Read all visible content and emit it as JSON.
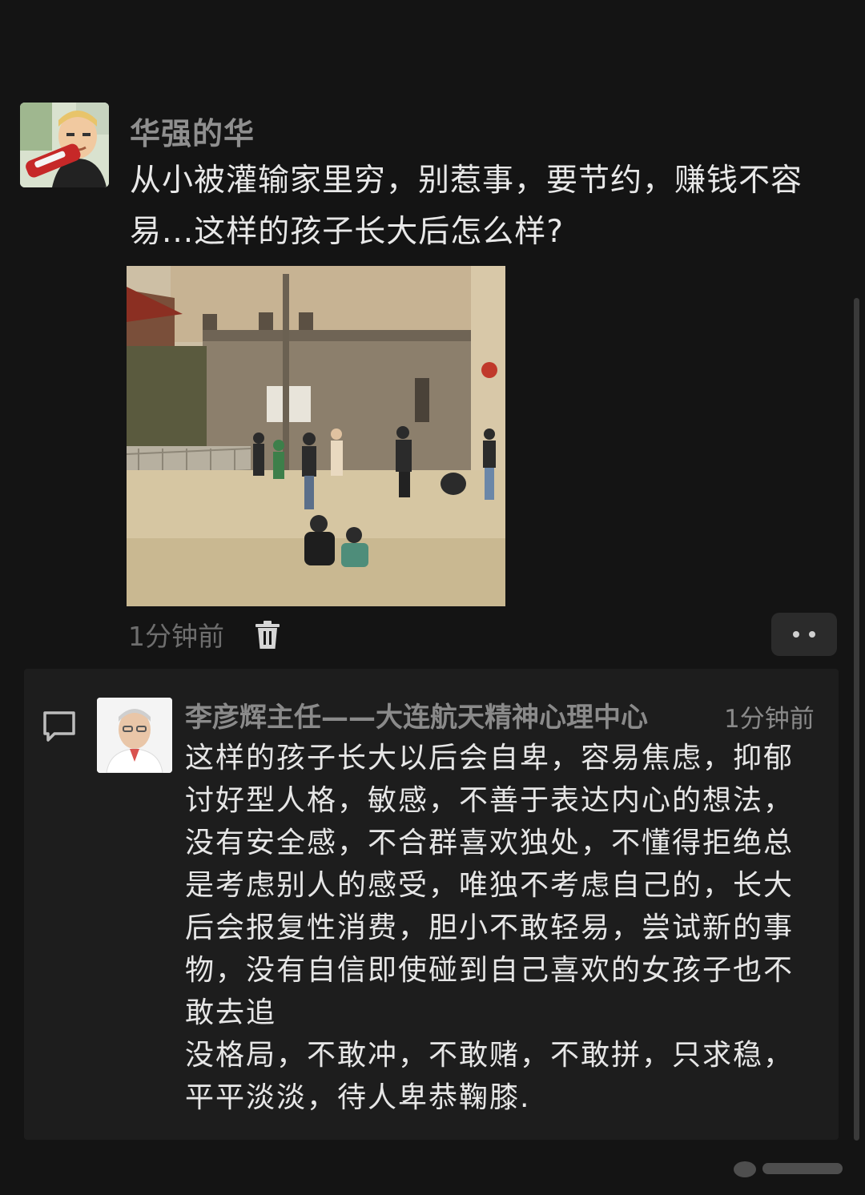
{
  "post": {
    "username": "华强的华",
    "text": "从小被灌输家里穷，别惹事，要节约，赚钱不容易...这样的孩子长大后怎么样?",
    "time": "1分钟前",
    "avatar_icon": "cartoon-man-avatar",
    "image_subject": "children-playing-in-village-yard"
  },
  "comment": {
    "author": "李彦辉主任——大连航天精神心理中心",
    "time": "1分钟前",
    "text": "这样的孩子长大以后会自卑，容易焦虑，抑郁讨好型人格，敏感，不善于表达内心的想法，没有安全感，不合群喜欢独处，不懂得拒绝总是考虑别人的感受，唯独不考虑自己的，长大后会报复性消费，胆小不敢轻易，尝试新的事物，没有自信即使碰到自己喜欢的女孩子也不敢去追\n没格局，不敢冲，不敢赌，不敢拼，只求稳，平平淡淡，待人卑恭鞠膝.",
    "avatar_icon": "doctor-avatar"
  },
  "colors": {
    "background": "#141414",
    "comment_background": "#1d1d1d",
    "muted_text": "#8a8a8a",
    "body_text": "#e6e6e6"
  }
}
